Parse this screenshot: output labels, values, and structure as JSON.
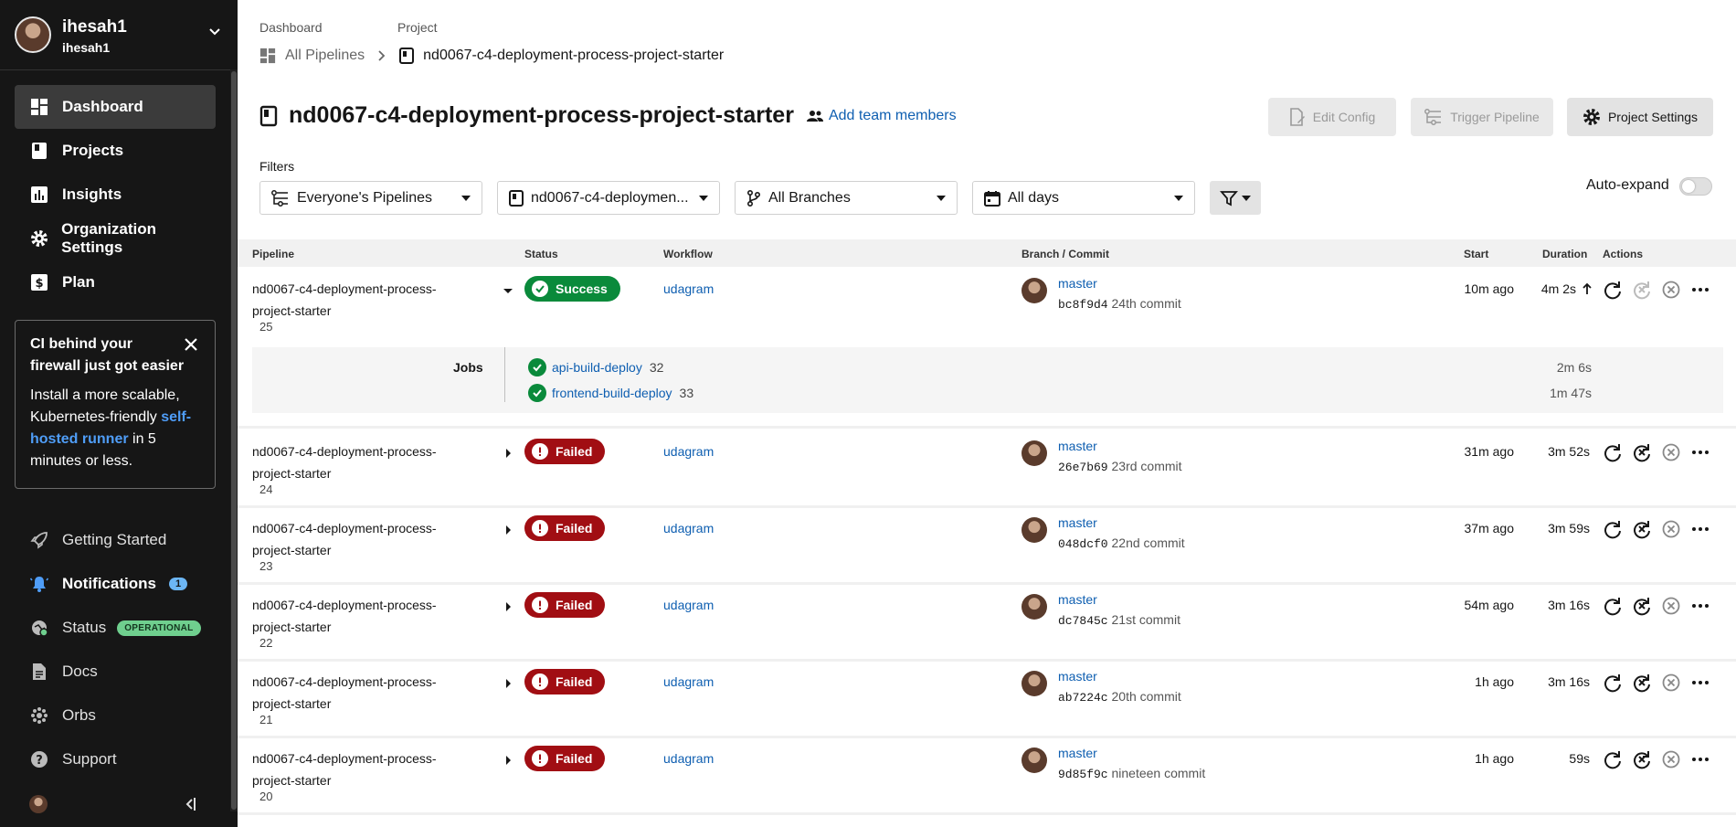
{
  "sidebar": {
    "user": {
      "name": "ihesah1",
      "org": "ihesah1"
    },
    "nav": [
      {
        "label": "Dashboard",
        "icon": "dashboard-icon"
      },
      {
        "label": "Projects",
        "icon": "projects-icon"
      },
      {
        "label": "Insights",
        "icon": "insights-icon"
      },
      {
        "label": "Organization Settings",
        "icon": "gear-icon"
      },
      {
        "label": "Plan",
        "icon": "dollar-icon"
      }
    ],
    "promo": {
      "title": "CI behind your firewall just got easier",
      "body_prefix": "Install a more scalable, Kubernetes-friendly ",
      "link": "self-hosted runner",
      "body_suffix": " in 5 minutes or less."
    },
    "bottom": [
      {
        "label": "Getting Started",
        "icon": "rocket-icon"
      },
      {
        "label": "Notifications",
        "icon": "bell-icon",
        "count": "1"
      },
      {
        "label": "Status",
        "icon": "status-icon",
        "badge": "OPERATIONAL"
      },
      {
        "label": "Docs",
        "icon": "document-icon"
      },
      {
        "label": "Orbs",
        "icon": "orbs-icon"
      },
      {
        "label": "Support",
        "icon": "help-icon"
      }
    ]
  },
  "breadcrumb": {
    "dashboard_label": "Dashboard",
    "project_label": "Project",
    "all_pipelines": "All Pipelines",
    "project": "nd0067-c4-deployment-process-project-starter"
  },
  "header": {
    "title": "nd0067-c4-deployment-process-project-starter",
    "add_team": "Add team members",
    "edit_config": "Edit Config",
    "trigger": "Trigger Pipeline",
    "settings": "Project Settings"
  },
  "filters": {
    "label": "Filters",
    "pipelines": "Everyone's Pipelines",
    "project": "nd0067-c4-deploymen...",
    "branches": "All Branches",
    "days": "All days",
    "auto_expand": "Auto-expand"
  },
  "table": {
    "columns": {
      "pipeline": "Pipeline",
      "status": "Status",
      "workflow": "Workflow",
      "branch": "Branch / Commit",
      "start": "Start",
      "duration": "Duration",
      "actions": "Actions"
    },
    "rows": [
      {
        "name": "nd0067-c4-deployment-process-project-starter",
        "num": "25",
        "status": "Success",
        "workflow": "udagram",
        "branch": "master",
        "sha": "bc8f9d4",
        "msg": "24th commit",
        "start": "10m ago",
        "duration": "4m 2s"
      },
      {
        "name": "nd0067-c4-deployment-process-project-starter",
        "num": "24",
        "status": "Failed",
        "workflow": "udagram",
        "branch": "master",
        "sha": "26e7b69",
        "msg": "23rd commit",
        "start": "31m ago",
        "duration": "3m 52s"
      },
      {
        "name": "nd0067-c4-deployment-process-project-starter",
        "num": "23",
        "status": "Failed",
        "workflow": "udagram",
        "branch": "master",
        "sha": "048dcf0",
        "msg": "22nd commit",
        "start": "37m ago",
        "duration": "3m 59s"
      },
      {
        "name": "nd0067-c4-deployment-process-project-starter",
        "num": "22",
        "status": "Failed",
        "workflow": "udagram",
        "branch": "master",
        "sha": "dc7845c",
        "msg": "21st commit",
        "start": "54m ago",
        "duration": "3m 16s"
      },
      {
        "name": "nd0067-c4-deployment-process-project-starter",
        "num": "21",
        "status": "Failed",
        "workflow": "udagram",
        "branch": "master",
        "sha": "ab7224c",
        "msg": "20th commit",
        "start": "1h ago",
        "duration": "3m 16s"
      },
      {
        "name": "nd0067-c4-deployment-process-project-starter",
        "num": "20",
        "status": "Failed",
        "workflow": "udagram",
        "branch": "master",
        "sha": "9d85f9c",
        "msg": "nineteen commit",
        "start": "1h ago",
        "duration": "59s"
      }
    ],
    "jobs": {
      "label": "Jobs",
      "items": [
        {
          "name": "api-build-deploy",
          "num": "32",
          "duration": "2m 6s"
        },
        {
          "name": "frontend-build-deploy",
          "num": "33",
          "duration": "1m 47s"
        }
      ]
    }
  },
  "colors": {
    "success": "#0a8a3b",
    "failed": "#a10e13",
    "link": "#0f5fb1",
    "sidebar": "#161616"
  }
}
